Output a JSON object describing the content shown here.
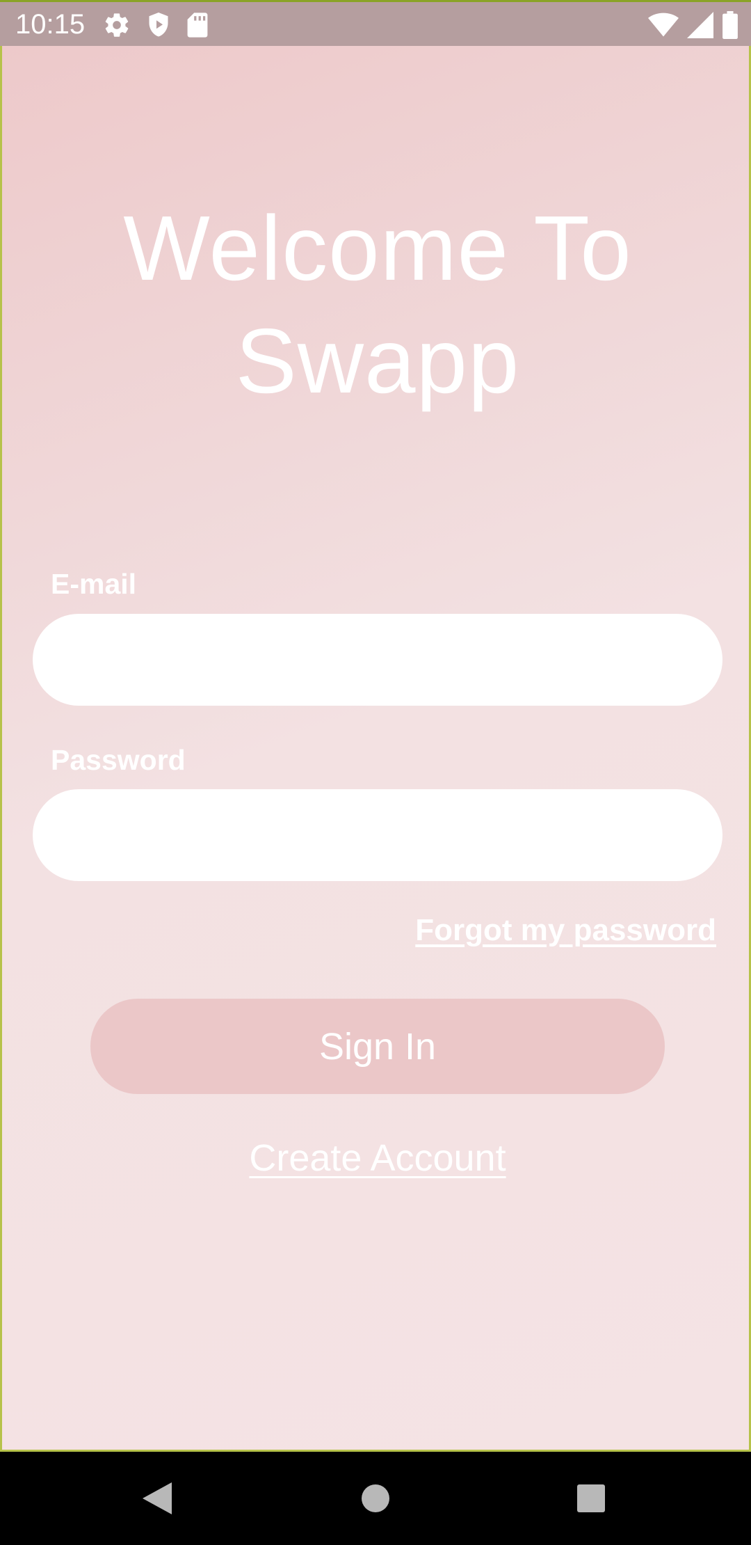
{
  "status_bar": {
    "time": "10:15",
    "left_icons": [
      "gear-icon",
      "shield-play-icon",
      "sd-card-icon"
    ],
    "right_icons": [
      "wifi-icon",
      "cell-signal-icon",
      "battery-icon"
    ]
  },
  "screen": {
    "title_line1": "Welcome To",
    "title_line2": "Swapp",
    "email_label": "E-mail",
    "email_value": "",
    "password_label": "Password",
    "password_value": "",
    "forgot_password": "Forgot my password",
    "sign_in": "Sign In",
    "create_account": "Create Account"
  },
  "colors": {
    "gradient_top": "#edc9ca",
    "gradient_bottom": "#f4e3e4",
    "button": "#ebc7c8",
    "status_bar": "#b59e9f",
    "text": "#ffffff"
  },
  "nav_bar": {
    "icons": [
      "back-triangle-icon",
      "home-circle-icon",
      "recents-square-icon"
    ]
  }
}
